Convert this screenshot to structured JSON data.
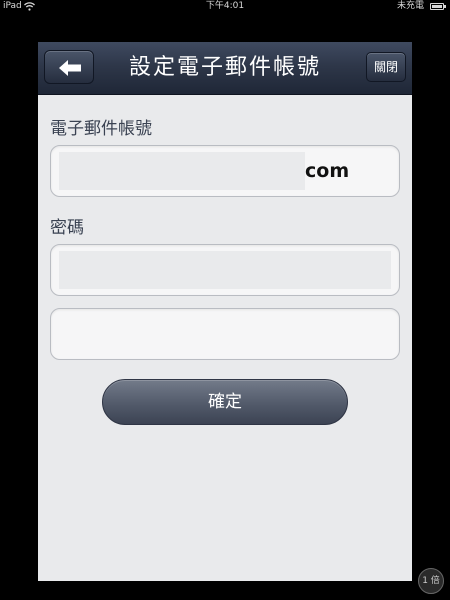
{
  "status_bar": {
    "device": "iPad",
    "time": "下午4:01",
    "charging": "未充電",
    "icons": [
      "wifi-icon",
      "battery-icon"
    ]
  },
  "nav": {
    "title": "設定電子郵件帳號",
    "close_label": "關閉",
    "back_icon": "arrow-left-icon"
  },
  "form": {
    "email_label": "電子郵件帳號",
    "email_value": "com",
    "password_label": "密碼",
    "password_value": "",
    "password_confirm_value": ""
  },
  "confirm_label": "確定",
  "zoom_badge": "1 倍",
  "colors": {
    "navbar": "#2e3749",
    "background": "#e9eaec",
    "button": "#525a6a",
    "label": "#3a4252"
  }
}
